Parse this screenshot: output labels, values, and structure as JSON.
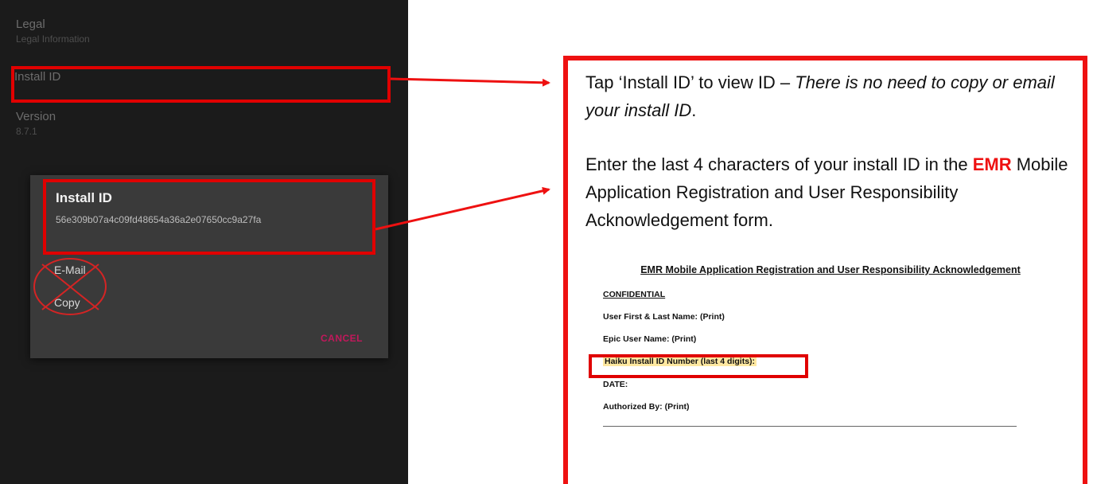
{
  "phone": {
    "legal_title": "Legal",
    "legal_subtitle": "Legal Information",
    "install_id_item": "Install ID",
    "version_title": "Version",
    "version_value": "8.7.1",
    "dialog": {
      "title": "Install ID",
      "install_id": "56e309b07a4c09fd48654a36a2e07650cc9a27fa",
      "email_label": "E-Mail",
      "copy_label": "Copy",
      "cancel_label": "CANCEL"
    }
  },
  "callout": {
    "para1_text": "Tap ‘Install ID’ to view ID – ",
    "para1_italic": "There is no need to copy or email your install ID",
    "para1_end": ".",
    "para2_before": "Enter the last 4 characters of your install ID in the ",
    "para2_emr": "EMR",
    "para2_after": " Mobile Application Registration and User Responsibility Acknowledgement form."
  },
  "form": {
    "title": "EMR Mobile Application Registration and User Responsibility Acknowledgement",
    "confidential": "CONFIDENTIAL",
    "user_name": "User First & Last Name: (Print)",
    "epic_user": "Epic User Name: (Print)",
    "haiku_id": "Haiku Install ID Number (last 4 digits):",
    "date": "DATE:",
    "authorized_by": "Authorized By: (Print)"
  },
  "colors": {
    "highlight_red": "#ee1111",
    "cancel_pink": "#c2185b",
    "form_highlight": "#ffe8a0"
  }
}
